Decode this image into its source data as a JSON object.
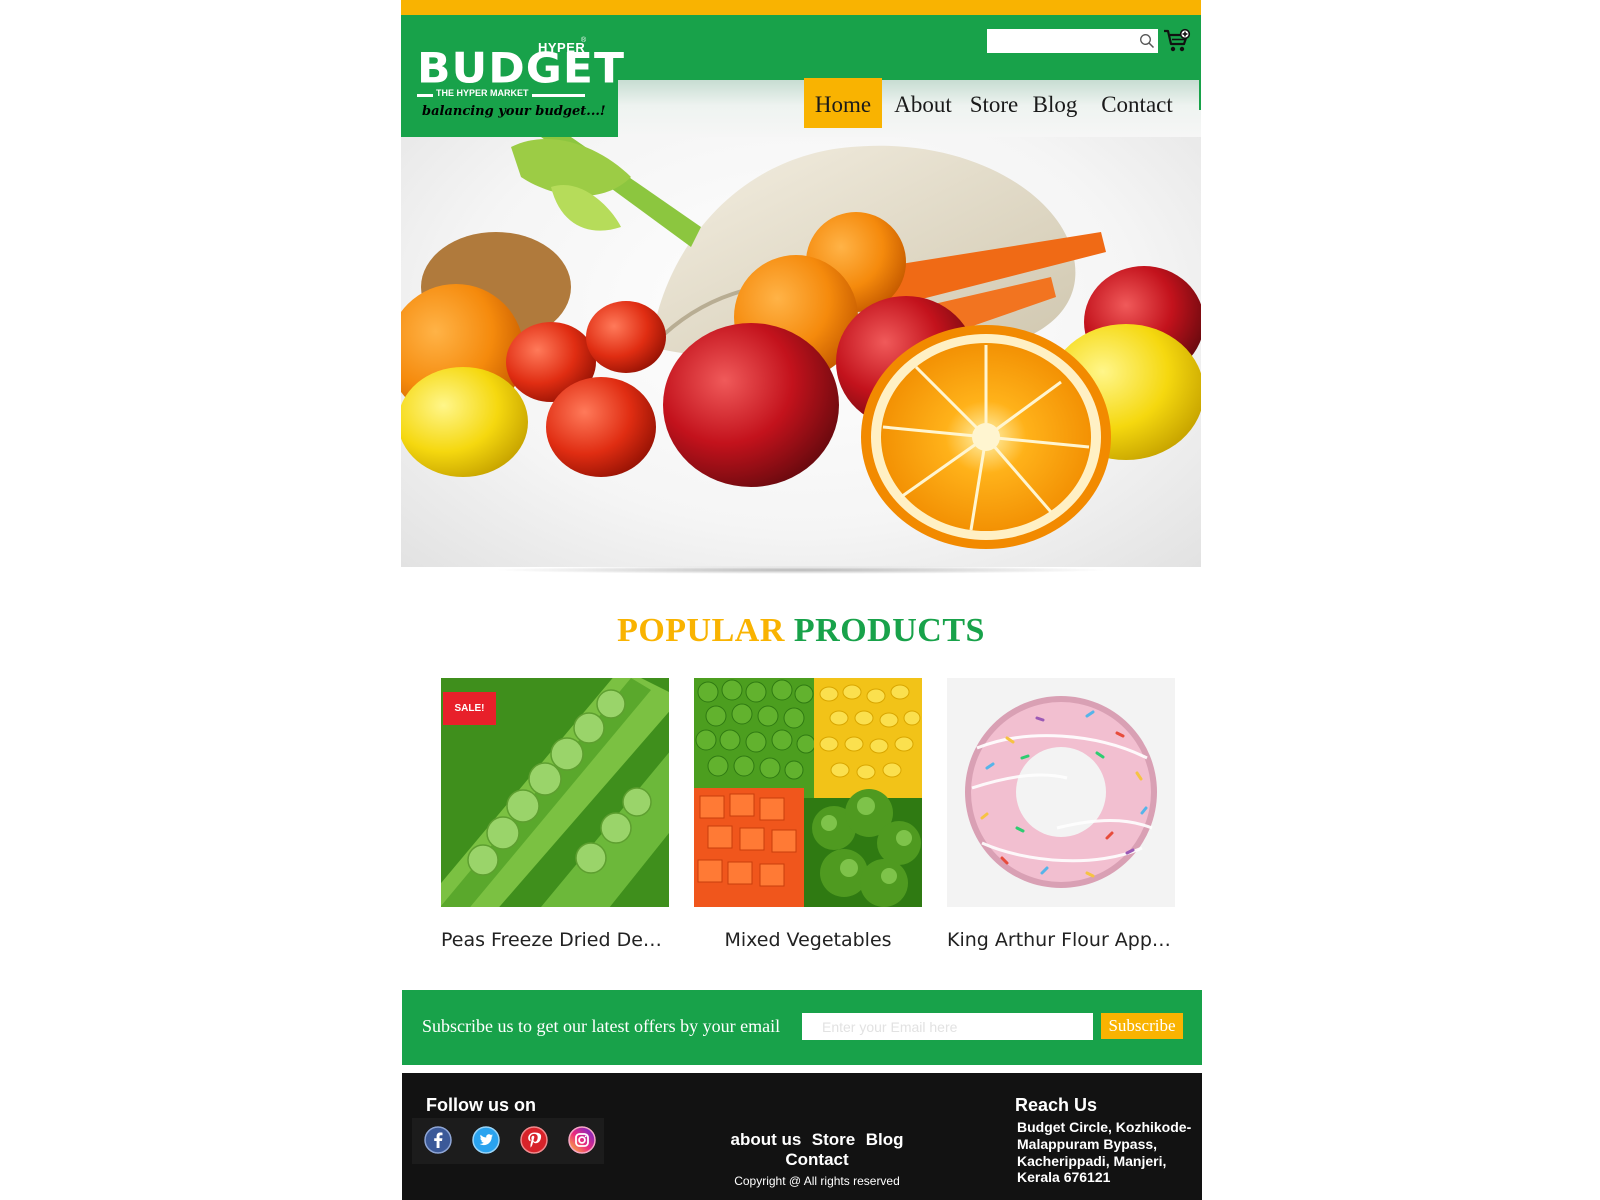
{
  "brand": {
    "hyper": "HYPER",
    "registered": "®",
    "name": "BUDGET",
    "subtitle": "THE HYPER MARKET",
    "tagline": "balancing your budget...!"
  },
  "colors": {
    "green": "#18a24a",
    "yellow": "#f9b301",
    "sale_red": "#e8202a",
    "footer_bg": "#121212"
  },
  "header": {
    "search": {
      "value": "",
      "placeholder": "",
      "icon": "search-icon"
    },
    "cart_icon": "cart-icon"
  },
  "nav": {
    "items": [
      {
        "label": "Home",
        "active": true
      },
      {
        "label": "About",
        "active": false
      },
      {
        "label": "Store",
        "active": false
      },
      {
        "label": "Blog",
        "active": false
      },
      {
        "label": "Contact",
        "active": false
      }
    ]
  },
  "popular": {
    "title_part1": "POPULAR",
    "title_part2": "PRODUCTS",
    "products": [
      {
        "name": "Peas Freeze Dried Dehydrated Vegetables",
        "badge": "SALE!"
      },
      {
        "name": "Mixed Vegetables",
        "badge": ""
      },
      {
        "name": "King Arthur Flour Apple Cider Donut",
        "badge": ""
      }
    ]
  },
  "subscribe": {
    "text": "Subscribe us to get our latest offers by your email",
    "input_placeholder": "Enter your Email here",
    "input_value": "",
    "button_label": "Subscribe"
  },
  "footer": {
    "follow_title": "Follow us on",
    "social_icons": [
      "facebook-icon",
      "twitter-icon",
      "pinterest-icon",
      "instagram-icon"
    ],
    "links": [
      "about us",
      "Store",
      "Blog",
      "Contact"
    ],
    "copyright": "Copyright @ All rights reserved",
    "reach_title": "Reach Us",
    "address_lines": [
      "Budget Circle, Kozhikode-",
      "Malappuram Bypass,",
      "Kacherippadi, Manjeri,",
      "Kerala 676121"
    ]
  }
}
